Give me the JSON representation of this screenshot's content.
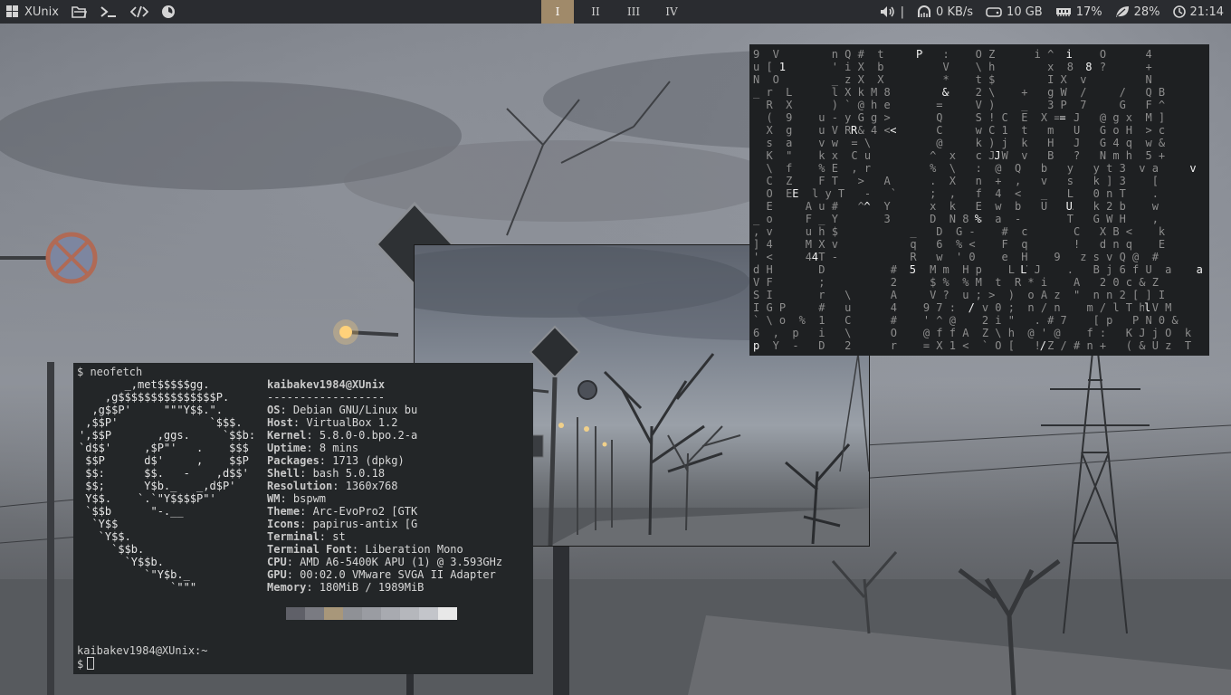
{
  "topbar": {
    "brand": "XUnix",
    "workspaces": [
      "I",
      "II",
      "III",
      "IV"
    ],
    "active_workspace": 0,
    "volume_sep": "|",
    "net": "0 KB/s",
    "disk": "10 GB",
    "ram": "17%",
    "cpu": "28%",
    "clock": "21:14",
    "icons": [
      "debian-logo-icon",
      "folder-icon",
      "terminal-icon",
      "code-icon",
      "browser-icon",
      "volume-icon",
      "network-icon",
      "disk-icon",
      "ram-icon",
      "cpu-leaf-icon",
      "clock-icon"
    ],
    "active_color": "#a08a6a",
    "bar_color": "#2a2c30"
  },
  "neofetch": {
    "command_prompt": "$ neofetch",
    "ascii": [
      "       _,met$$$$$gg.",
      "    ,g$$$$$$$$$$$$$$$P.",
      "  ,g$$P'     \"\"\"Y$$.\".",
      " ,$$P'              `$$$.",
      "',$$P       ,ggs.     `$$b:",
      "`d$$'     ,$P\"'   .    $$$",
      " $$P      d$'     ,    $$P",
      " $$:      $$.   -    ,d$$'",
      " $$;      Y$b._   _,d$P'",
      " Y$$.    `.`\"Y$$$$P\"'",
      " `$$b      \"-.__",
      "  `Y$$",
      "   `Y$$.",
      "     `$$b.",
      "       `Y$$b.",
      "          `\"Y$b._",
      "              `\"\"\""
    ],
    "userhost": "kaibakev1984@XUnix",
    "separator": "------------------",
    "info": [
      {
        "label": "OS",
        "value": "Debian GNU/Linux bu"
      },
      {
        "label": "Host",
        "value": "VirtualBox 1.2"
      },
      {
        "label": "Kernel",
        "value": "5.8.0-0.bpo.2-a"
      },
      {
        "label": "Uptime",
        "value": "8 mins"
      },
      {
        "label": "Packages",
        "value": "1713 (dpkg)"
      },
      {
        "label": "Shell",
        "value": "bash 5.0.18"
      },
      {
        "label": "Resolution",
        "value": "1360x768"
      },
      {
        "label": "WM",
        "value": "bspwm"
      },
      {
        "label": "Theme",
        "value": "Arc-EvoPro2 [GTK"
      },
      {
        "label": "Icons",
        "value": "papirus-antix [G"
      },
      {
        "label": "Terminal",
        "value": "st"
      },
      {
        "label": "Terminal Font",
        "value": "Liberation Mono"
      },
      {
        "label": "CPU",
        "value": "AMD A6-5400K APU (1) @ 3.593GHz"
      },
      {
        "label": "GPU",
        "value": "00:02.0 VMware SVGA II Adapter"
      },
      {
        "label": "Memory",
        "value": "180MiB / 1989MiB"
      }
    ],
    "palette": [
      "#5f6068",
      "#7a7b82",
      "#a8977a",
      "#8f9196",
      "#9a9ca2",
      "#a8aab0",
      "#b5b7bc",
      "#c3c5ca",
      "#e8e8e8"
    ],
    "prompt_user": "kaibakev1984@XUnix:~",
    "prompt_symbol": "$"
  },
  "matrix": {
    "lines": [
      "9  V        n Q #  t     P   :    O Z      i ^  j    O      4  ",
      "u [ 1       ' i X  b         V    \\ h        x  8    ?      +  ",
      "N  O        _ z X  X         *    t $        I X  v         N  ",
      "_ r  L      l X k M 8        &    2 \\    +   g W  /     /   Q B",
      "  R  X      ) ` @ h e       =     V )    _   3 P  7     G   F ^",
      "  (  9    u - y G g >       Q     S ! C  E  X =  J   @ g x  M ]",
      "  X  g    u V R & 4 <       C     w C 1  t   m   U   G o H  > c",
      "  s  a    v w  = \\          @     k ) j  k   H   J   G 4 q  w &",
      "  K  \"    k x  C u         ^  x   c J W  v   B   ?   N m h  5 +",
      "  \\  f    % E  , r         %  \\   :  @  Q   b   y   y t 3  v a",
      "  C  Z    F T   >   A      .  X   n  +  ,   v   s   k ] 3    [",
      "  O  E   l y T   -   `     ;  ,   f  4  <   _   L   0 n T    .",
      "  E     A u #   ^   Y      x  k   E  w  b   U   R   k 2 b    w",
      "_ o     F _ Y       3      D  N 8 %  a  -       T   G W H    ,",
      ", v     u h $           _   D  G -    #  c       C   X B <    k",
      "] 4     M X v           q   6  % <    F  q       !   d n q    E",
      "' <     4 T -           R   w  ' 0    e  H    9   z s v Q @  #",
      "d H       D          #  5  M m  H p    L Y J    .   B j 6 f U  a",
      "V F       ;          2     $ %  % M  t  R * i    A   2 0 c & Z",
      "S I       r   \\      A     V ?  u ; >  )  o A z  \"  n n 2 [ ] I",
      "I G P     #   u      4    9 7 :  / v 0 ;  n / n    m / l T h V M",
      "` \\ o  %  1   C      #    ' ^ @    2 i \"   . # 7    [ p   P N 0 &",
      "6  ,  p   i   \\      O    @ f f A  Z \\ h  @ ' @    f :   K J j O  k",
      "p  Y  -   D   2      r    = X 1 <  ` O [   ! Z / # n +   ( & U z  T"
    ],
    "bright": [
      {
        "line": 0,
        "col": 25,
        "ch": "P"
      },
      {
        "line": 0,
        "col": 48,
        "ch": "i"
      },
      {
        "line": 1,
        "col": 4,
        "ch": "1"
      },
      {
        "line": 1,
        "col": 51,
        "ch": "8"
      },
      {
        "line": 3,
        "col": 29,
        "ch": "&"
      },
      {
        "line": 5,
        "col": 47,
        "ch": "="
      },
      {
        "line": 6,
        "col": 15,
        "ch": "R"
      },
      {
        "line": 6,
        "col": 21,
        "ch": "<"
      },
      {
        "line": 8,
        "col": 37,
        "ch": "J"
      },
      {
        "line": 9,
        "col": 67,
        "ch": "v"
      },
      {
        "line": 11,
        "col": 6,
        "ch": "E"
      },
      {
        "line": 12,
        "col": 17,
        "ch": "^"
      },
      {
        "line": 12,
        "col": 48,
        "ch": "U"
      },
      {
        "line": 13,
        "col": 34,
        "ch": "%"
      },
      {
        "line": 16,
        "col": 9,
        "ch": "4"
      },
      {
        "line": 17,
        "col": 24,
        "ch": "5"
      },
      {
        "line": 17,
        "col": 41,
        "ch": "L"
      },
      {
        "line": 17,
        "col": 68,
        "ch": "a"
      },
      {
        "line": 20,
        "col": 33,
        "ch": "/"
      },
      {
        "line": 20,
        "col": 60,
        "ch": "l"
      },
      {
        "line": 23,
        "col": 0,
        "ch": "p"
      },
      {
        "line": 23,
        "col": 44,
        "ch": "/"
      }
    ]
  }
}
